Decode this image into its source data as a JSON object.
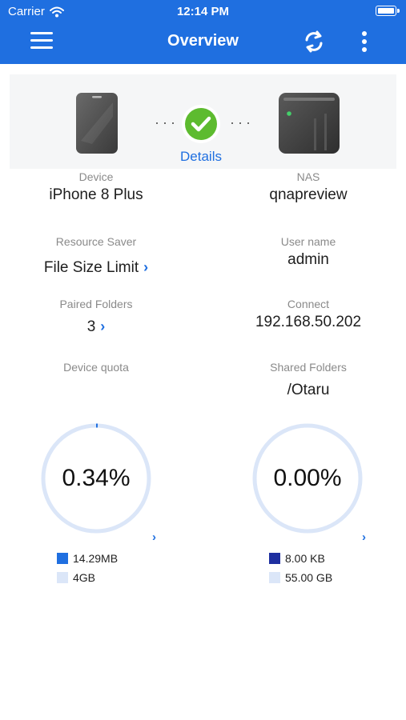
{
  "status_bar": {
    "carrier": "Carrier",
    "time": "12:14 PM"
  },
  "nav": {
    "title": "Overview",
    "icons": [
      "menu-icon",
      "sync-icon",
      "more-vertical-icon"
    ]
  },
  "connection": {
    "dots_left": "···",
    "dots_right": "···",
    "details_label": "Details",
    "status_color": "#5dbb2f"
  },
  "info": {
    "device": {
      "label": "Device",
      "value": "iPhone 8 Plus"
    },
    "nas": {
      "label": "NAS",
      "value": "qnapreview"
    },
    "resource_saver": {
      "label": "Resource Saver",
      "value": "File Size Limit"
    },
    "user_name": {
      "label": "User name",
      "value": "admin"
    },
    "paired_folders": {
      "label": "Paired Folders",
      "value": "3"
    },
    "connect": {
      "label": "Connect",
      "value": "192.168.50.202"
    },
    "device_quota": {
      "label": "Device quota"
    },
    "shared_folders": {
      "label": "Shared Folders",
      "value": "/Otaru"
    }
  },
  "quota": {
    "device": {
      "percent_text": "0.34%",
      "fraction": 0.0034,
      "used_label": "14.29MB",
      "total_label": "4GB",
      "used_color": "#1f6fe0",
      "total_color": "#dbe6f8"
    },
    "shared": {
      "percent_text": "0.00%",
      "fraction": 0.0,
      "used_label": "8.00 KB",
      "total_label": "55.00 GB",
      "used_color": "#1e2fa0",
      "total_color": "#dbe6f8"
    }
  },
  "colors": {
    "accent": "#1f6fe0",
    "ring": "#dbe6f8"
  }
}
